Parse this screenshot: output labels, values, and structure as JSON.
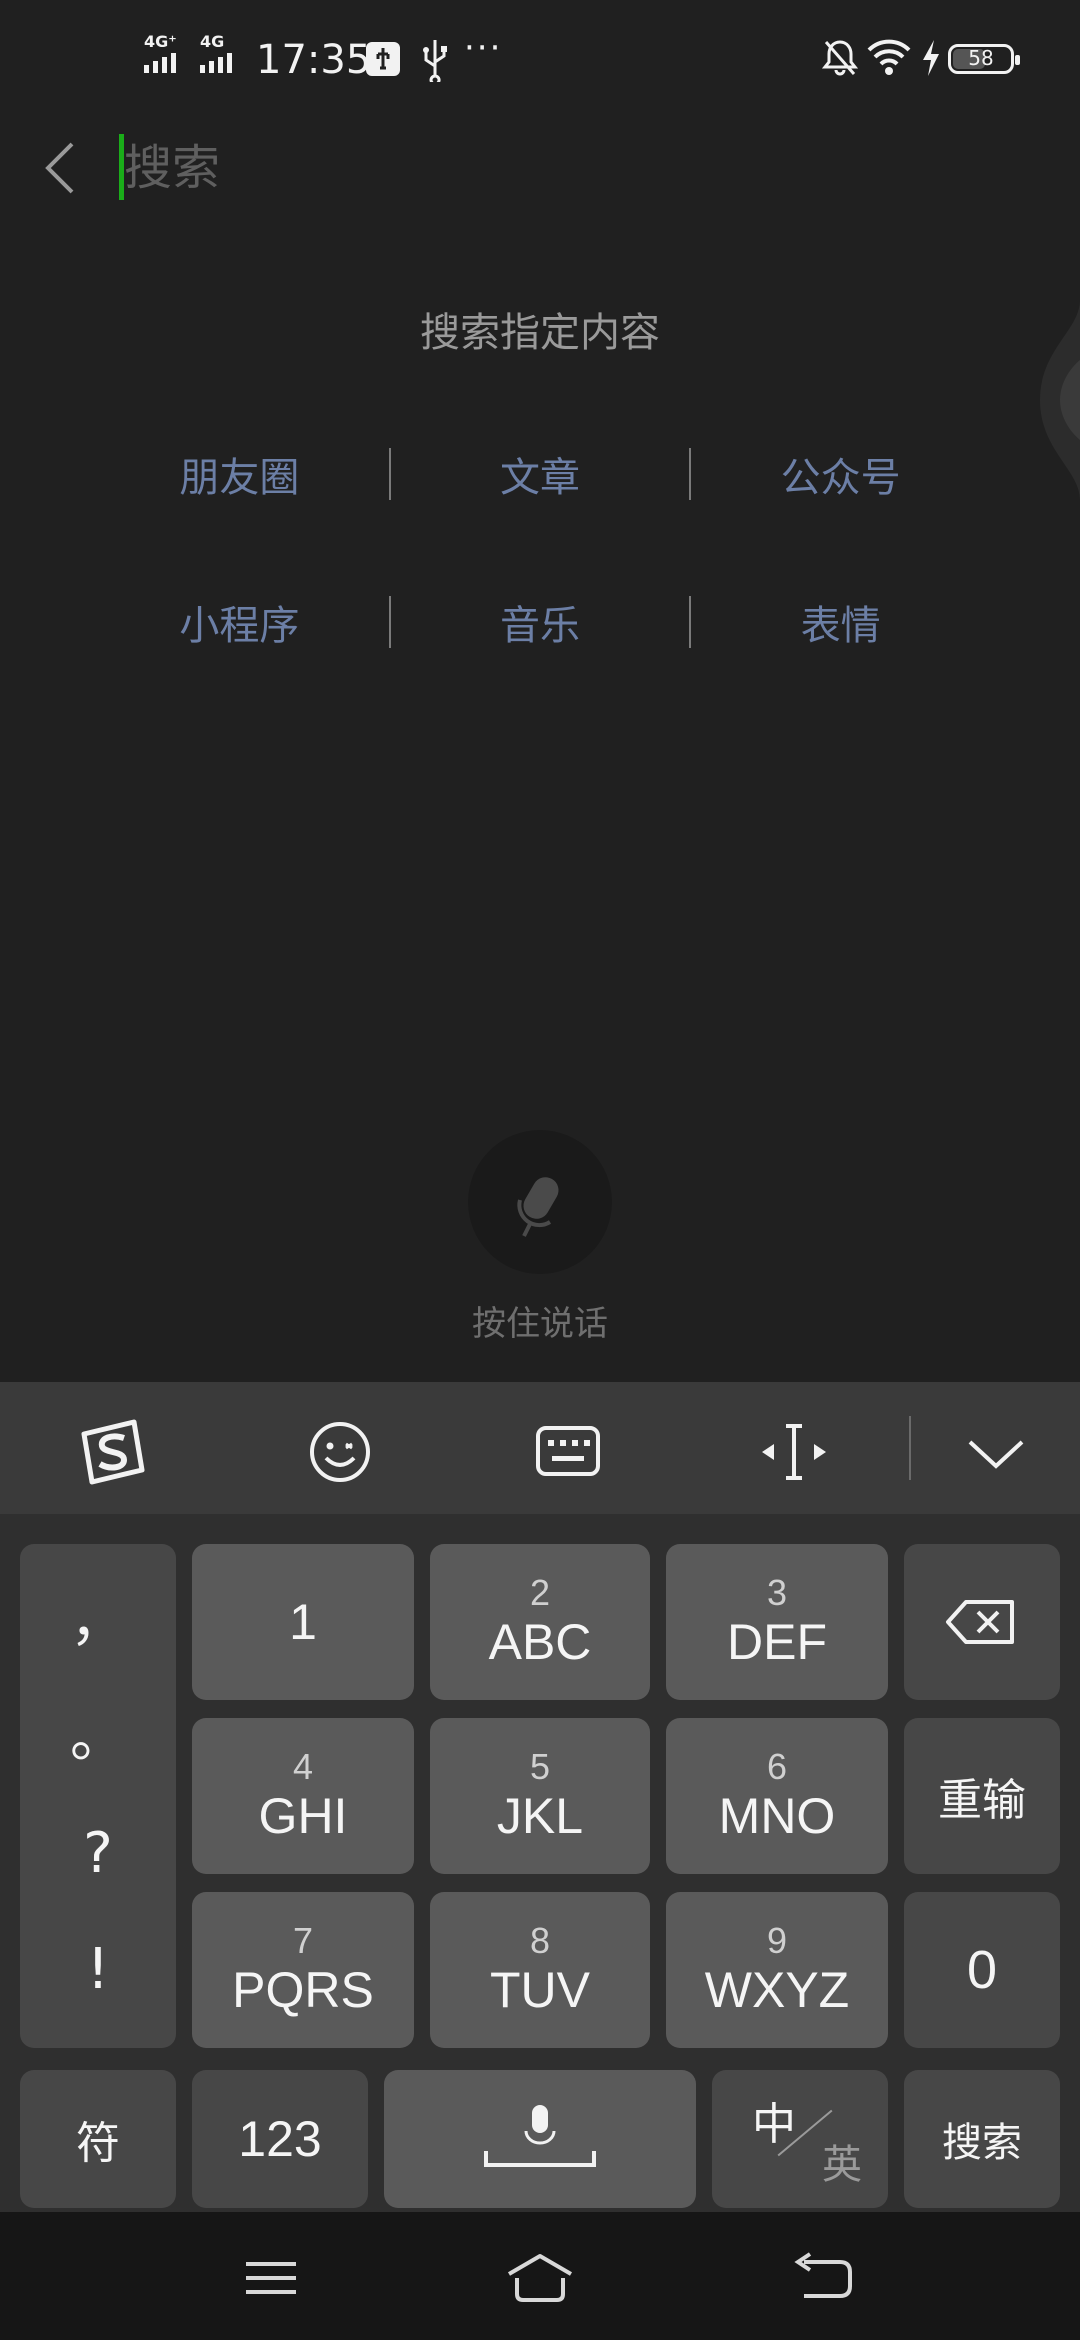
{
  "status_bar": {
    "network1": "4G⁺",
    "network2": "4G",
    "time": "17:35",
    "more": "···",
    "battery": "58",
    "battery_level": 0.58
  },
  "search": {
    "placeholder": "搜索",
    "value": ""
  },
  "hint": "搜索指定内容",
  "categories": [
    [
      "朋友圈",
      "文章",
      "公众号"
    ],
    [
      "小程序",
      "音乐",
      "表情"
    ]
  ],
  "voice": {
    "label": "按住说话"
  },
  "keyboard": {
    "toolbar_icons": [
      "sogou-logo-icon",
      "emoji-icon",
      "keyboard-icon",
      "cursor-move-icon",
      "collapse-icon"
    ],
    "punctuation": [
      "，",
      "。",
      "?",
      "!"
    ],
    "keys": {
      "k1": {
        "num": "",
        "letters": "1"
      },
      "k2": {
        "num": "2",
        "letters": "ABC"
      },
      "k3": {
        "num": "3",
        "letters": "DEF"
      },
      "k4": {
        "num": "4",
        "letters": "GHI"
      },
      "k5": {
        "num": "5",
        "letters": "JKL"
      },
      "k6": {
        "num": "6",
        "letters": "MNO"
      },
      "k7": {
        "num": "7",
        "letters": "PQRS"
      },
      "k8": {
        "num": "8",
        "letters": "TUV"
      },
      "k9": {
        "num": "9",
        "letters": "WXYZ"
      }
    },
    "reinput": "重输",
    "zero": "0",
    "symbols": "符",
    "numbers": "123",
    "lang_zh": "中",
    "lang_en": "英",
    "search": "搜索"
  },
  "nav_icons": [
    "menu-icon",
    "home-icon",
    "back-icon"
  ]
}
